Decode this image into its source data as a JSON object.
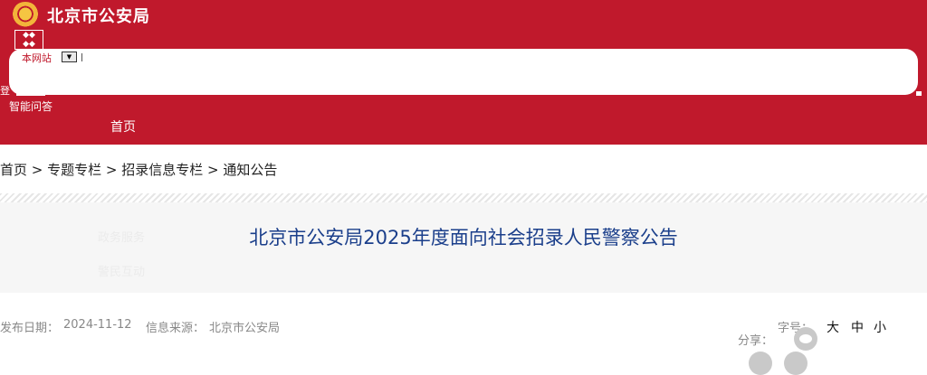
{
  "header": {
    "site_title": "北京市公安局",
    "scope_label": "本网站",
    "scope_dropdown_glyph": "▼",
    "login_fragment": "登",
    "smart_qa": "智能问答",
    "nav_home": "首页"
  },
  "breadcrumb": "首页 > 专题专栏 > 招录信息专栏 > 通知公告",
  "nav_ghost": [
    "政务服务",
    "警民互动"
  ],
  "article": {
    "title": "北京市公安局2025年度面向社会招录人民警察公告",
    "date_label": "发布日期：",
    "date": "2024-11-12",
    "source_label": "信息来源：",
    "source": "北京市公安局"
  },
  "tools": {
    "font_size_label": "字号：",
    "font_large": "大",
    "font_medium": "中",
    "font_small": "小",
    "share_label": "分享："
  },
  "colors": {
    "brand_red": "#c0192c",
    "title_blue": "#1b3f8b"
  },
  "icons": [
    "police-emblem-icon",
    "wechat-icon",
    "weibo-icon",
    "qzone-icon"
  ]
}
